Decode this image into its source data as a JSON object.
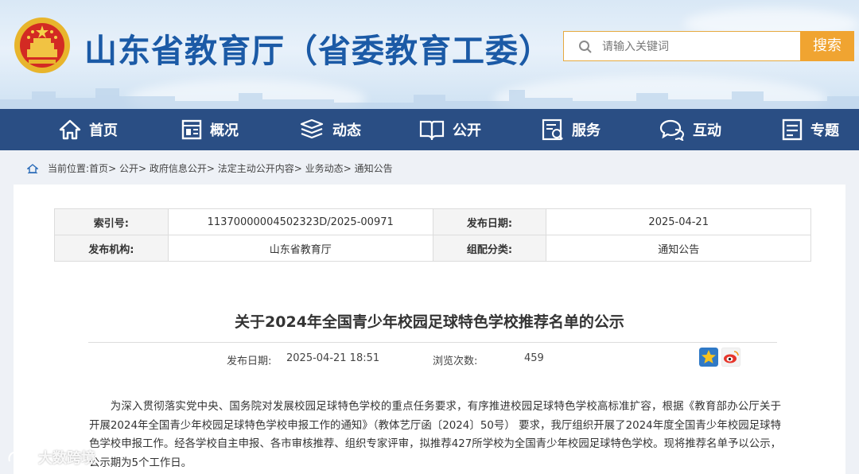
{
  "header": {
    "site_title": "山东省教育厅（省委教育工委）",
    "search_placeholder": "请输入关键词",
    "search_button": "搜索"
  },
  "nav": [
    {
      "label": "首页",
      "icon": "home-icon"
    },
    {
      "label": "概况",
      "icon": "overview-icon"
    },
    {
      "label": "动态",
      "icon": "news-icon"
    },
    {
      "label": "公开",
      "icon": "book-icon"
    },
    {
      "label": "服务",
      "icon": "service-icon"
    },
    {
      "label": "互动",
      "icon": "chat-icon"
    },
    {
      "label": "专题",
      "icon": "topic-icon"
    }
  ],
  "breadcrumb": {
    "prefix": "当前位置:",
    "items": [
      "首页",
      "公开",
      "政府信息公开",
      "法定主动公开内容",
      "业务动态",
      "通知公告"
    ],
    "sep": ">"
  },
  "meta": {
    "index_label": "索引号:",
    "index_value": "11370000004502323D/2025-00971",
    "date_label": "发布日期:",
    "date_value": "2025-04-21",
    "org_label": "发布机构:",
    "org_value": "山东省教育厅",
    "category_label": "组配分类:",
    "category_value": "通知公告"
  },
  "article": {
    "title": "关于2024年全国青少年校园足球特色学校推荐名单的公示",
    "publish_label": "发布日期:",
    "publish_value": "2025-04-21 18:51",
    "views_label": "浏览次数:",
    "views_value": "459",
    "body": "为深入贯彻落实党中央、国务院对发展校园足球特色学校的重点任务要求，有序推进校园足球特色学校高标准扩容，根据《教育部办公厅关于开展2024年全国青少年校园足球特色学校申报工作的通知》（教体艺厅函〔2024〕50号） 要求，我厅组织开展了2024年度全国青少年校园足球特色学校申报工作。经各学校自主申报、各市审核推荐、组织专家评审，拟推荐427所学校为全国青少年校园足球特色学校。现将推荐名单予以公示，公示期为5个工作日。"
  },
  "watermark": "大数跨境",
  "colors": {
    "brand_blue": "#1b5aa6",
    "nav_bg": "#2a4e84",
    "search_orange": "#f0a431"
  }
}
